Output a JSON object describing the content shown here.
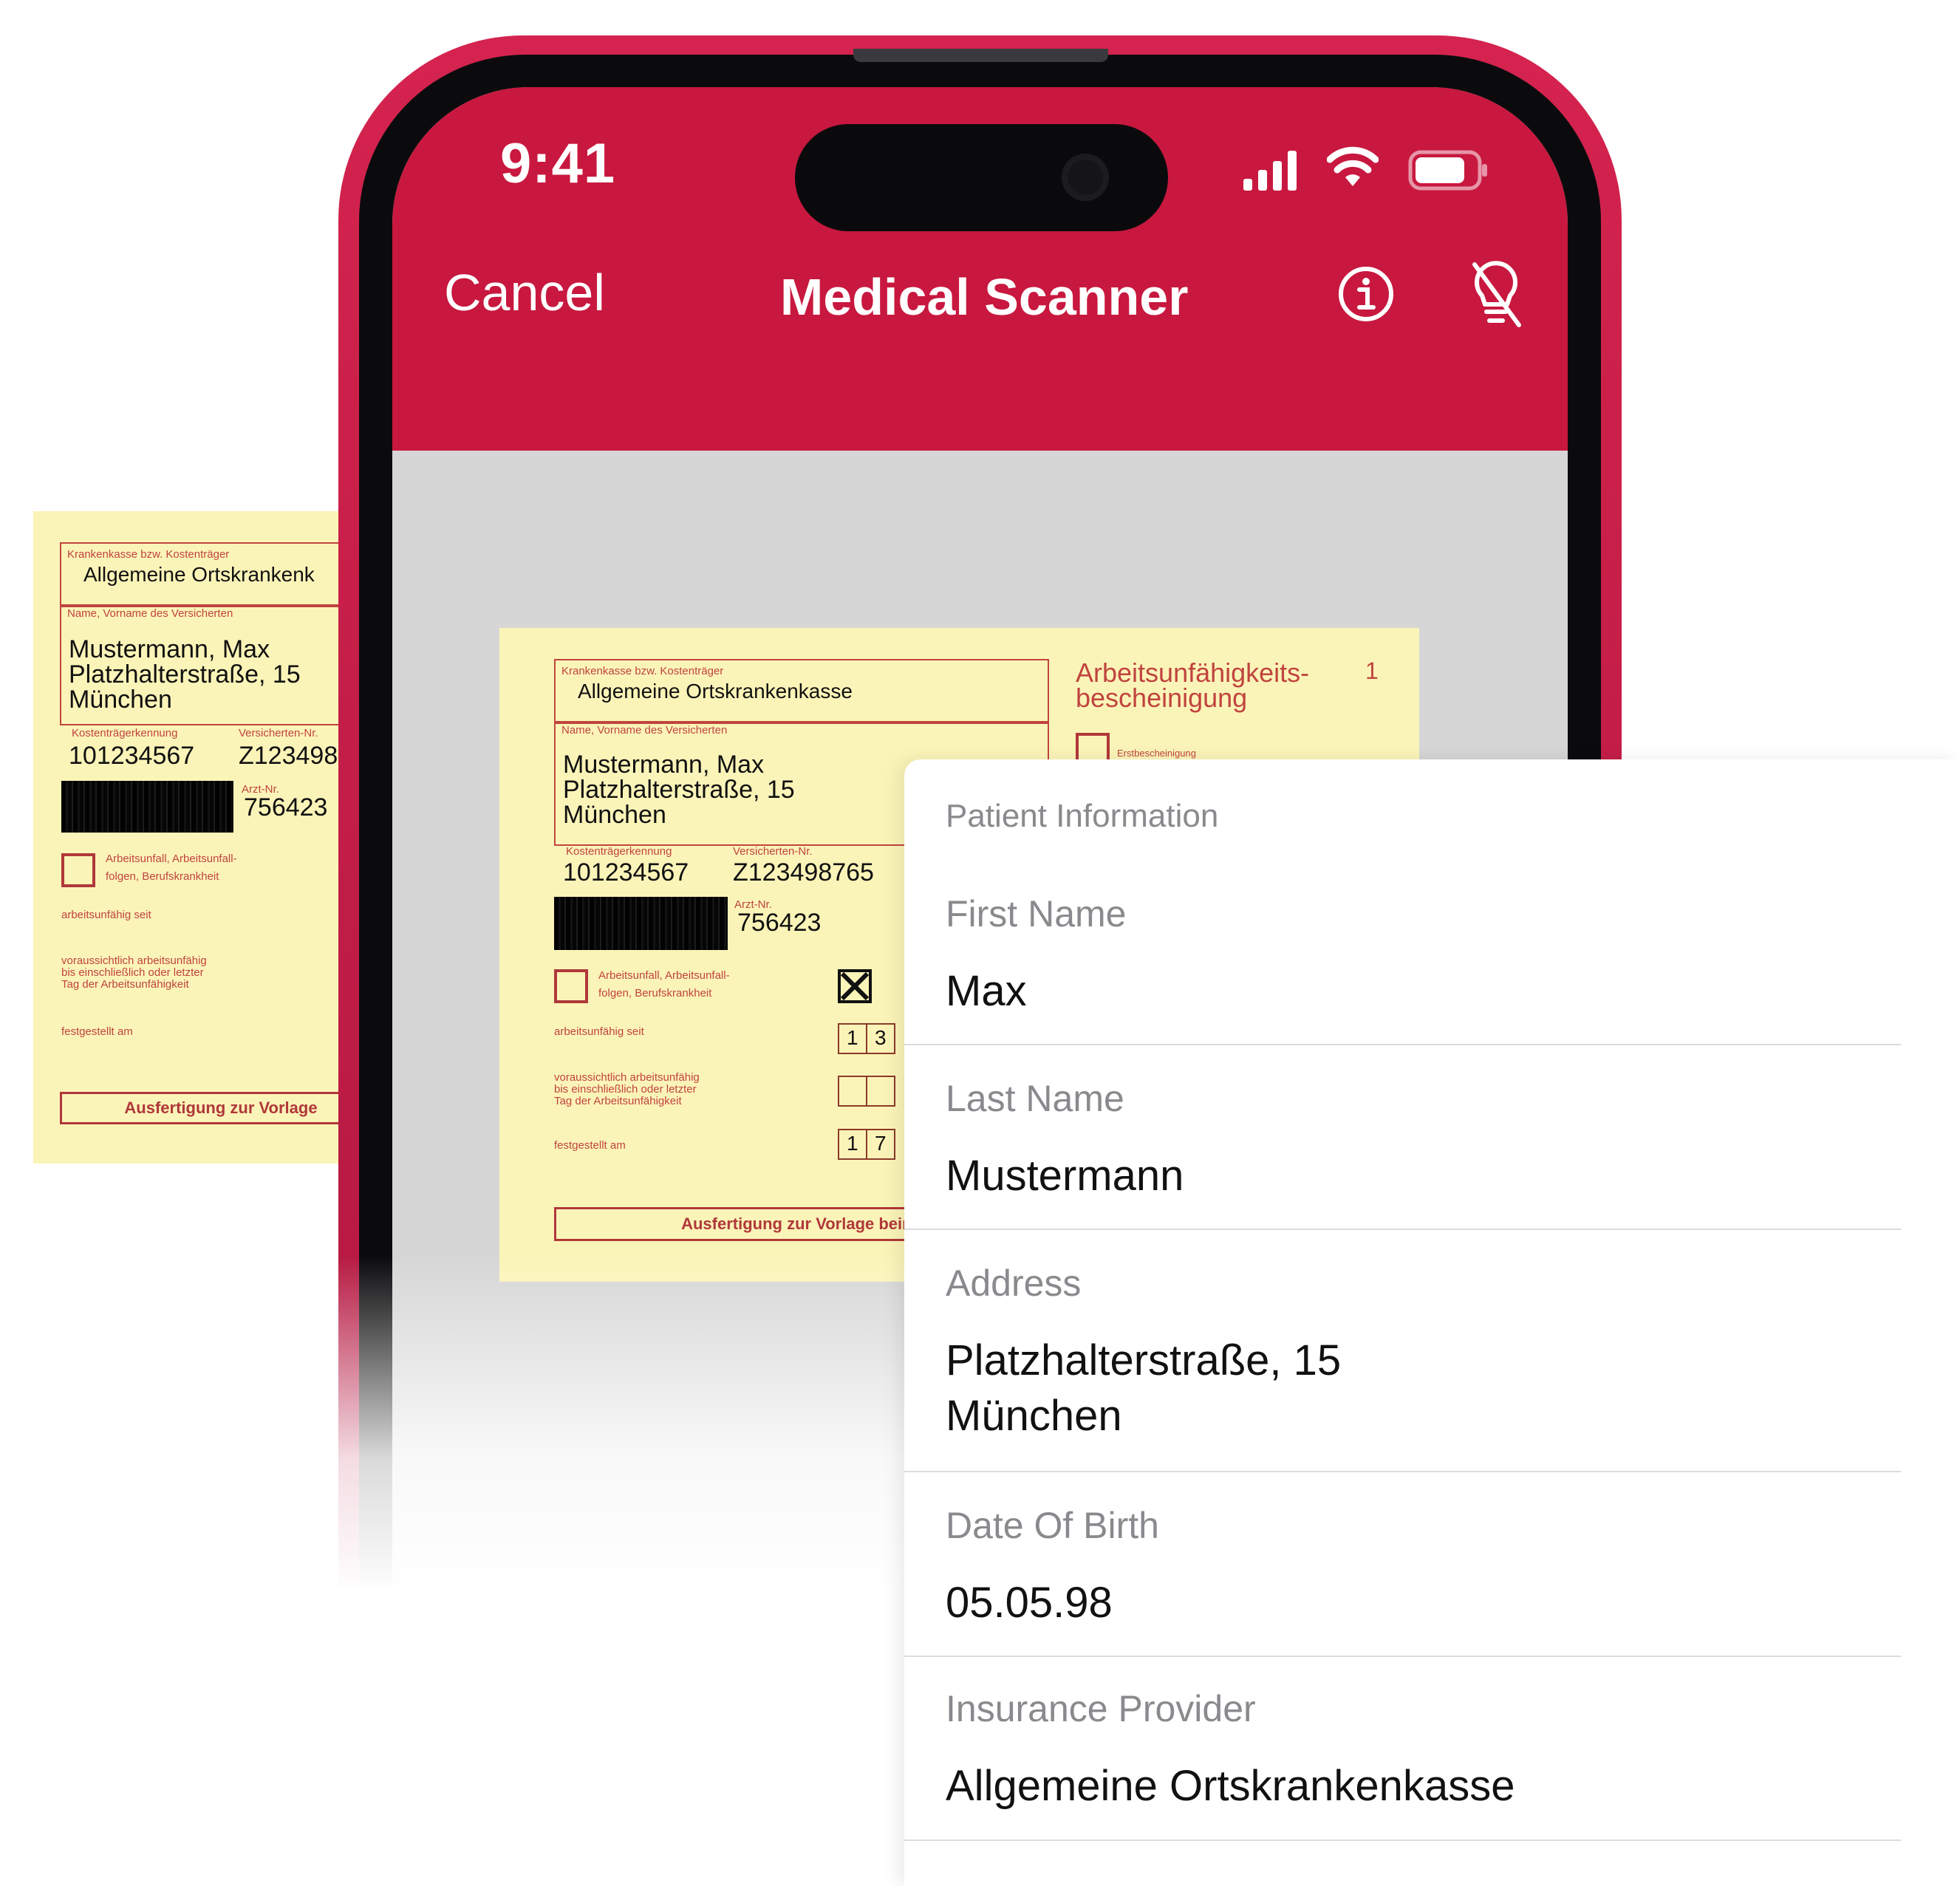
{
  "status_bar": {
    "time": "9:41"
  },
  "nav": {
    "cancel_label": "Cancel",
    "title": "Medical Scanner"
  },
  "document": {
    "insurer_label": "Krankenkasse bzw. Kostenträger",
    "insurer": "Allgemeine Ortskrankenkasse",
    "name_label": "Name, Vorname des Versicherten",
    "name": "Mustermann, Max",
    "street": "Platzhalterstraße, 15",
    "city": "München",
    "kostentraeger_label": "Kostenträgerkennung",
    "kostentraeger": "101234567",
    "versicherten_label": "Versicherten-Nr.",
    "versicherten": "Z123498765",
    "arzt_label": "Arzt-Nr.",
    "arzt": "756423",
    "form_title_1": "Arbeitsunfähigkeits-",
    "form_title_2": "bescheinigung",
    "form_number": "1",
    "erst_label": "Erstbescheinigung",
    "unfall_1": "Arbeitsunfall, Arbeitsunfall-",
    "unfall_2": "folgen, Berufskrankheit",
    "au_seit": "arbeitsunfähig seit",
    "voraus_1": "voraussichtlich arbeitsunfähig",
    "voraus_2": "bis einschließlich oder letzter",
    "voraus_3": "Tag der Arbeitsunfähigkeit",
    "festgestellt": "festgestellt am",
    "date_a": [
      "1",
      "3"
    ],
    "date_c": [
      "1",
      "7"
    ],
    "left_bottom": "Ausfertigung zur Vorlage",
    "main_bottom": "Ausfertigung zur Vorlage beim Arb",
    "left_insurer": "Allgemeine Ortskrankenk",
    "left_versicherten": "Z123498",
    "left_arzt": "756423"
  },
  "result": {
    "section_title": "Patient Information",
    "fields": [
      {
        "label": "First Name",
        "value": "Max"
      },
      {
        "label": "Last Name",
        "value": "Mustermann"
      },
      {
        "label": "Address",
        "value": "Platzhalterstraße, 15\nMünchen"
      },
      {
        "label": "Date Of Birth",
        "value": "05.05.98"
      },
      {
        "label": "Insurance Provider",
        "value": "Allgemeine Ortskrankenkasse"
      }
    ]
  },
  "colors": {
    "brand_red": "#c8183f",
    "paper": "#fbf4b8",
    "form_red": "#c0443f"
  },
  "icons": [
    "signal-icon",
    "wifi-icon",
    "battery-icon",
    "info-icon",
    "flash-off-icon"
  ]
}
